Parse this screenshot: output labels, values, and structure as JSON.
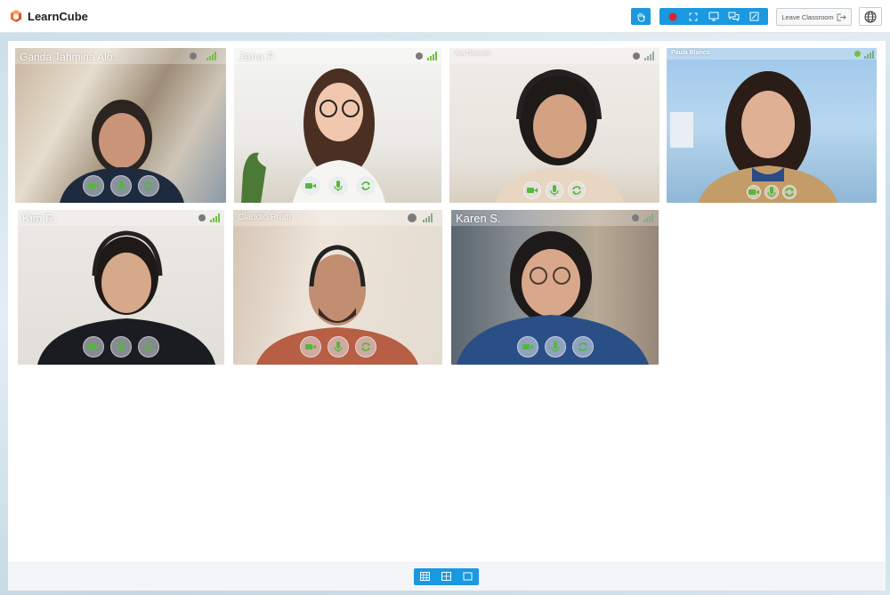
{
  "app": {
    "brand": "LearnCube"
  },
  "toolbar": {
    "leave_label": "Leave Classroom",
    "icons": [
      "hand-icon",
      "record-icon",
      "fullscreen-icon",
      "screen-share-icon",
      "chat-icon",
      "whiteboard-icon"
    ]
  },
  "participants": [
    {
      "name": "Ganda Tahmina Alo..."
    },
    {
      "name": "Jana P."
    },
    {
      "name": "Jon Oroncio"
    },
    {
      "name": "Paula Blanco"
    },
    {
      "name": "Kim R."
    },
    {
      "name": "Claudio Pruiti"
    },
    {
      "name": "Karen S."
    }
  ],
  "layouts": [
    "grid-icon",
    "quad-icon",
    "single-icon"
  ],
  "colors": {
    "accent": "#1a98e0",
    "signal": "#72c043",
    "record": "#e0232f"
  }
}
